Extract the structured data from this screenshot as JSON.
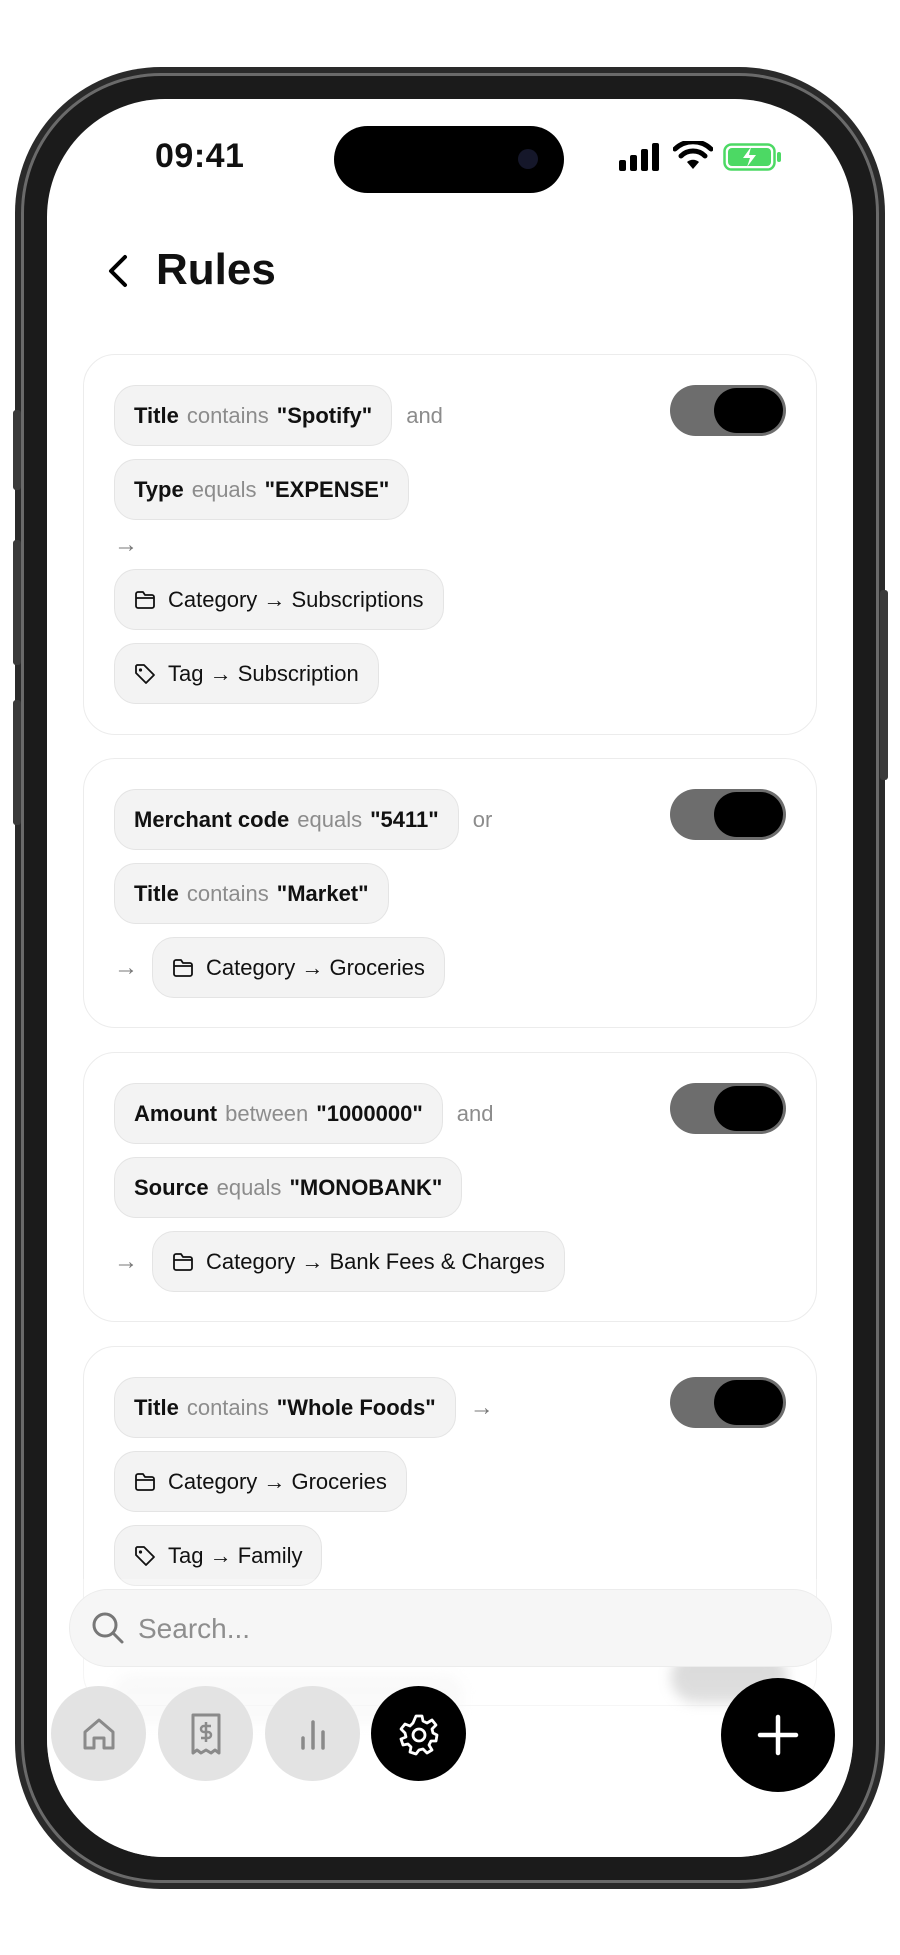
{
  "status": {
    "time": "09:41"
  },
  "header": {
    "title": "Rules"
  },
  "rules": [
    {
      "conditions": [
        {
          "field": "Title",
          "op": "contains",
          "value": "\"Spotify\"",
          "conj": "and"
        },
        {
          "field": "Type",
          "op": "equals",
          "value": "\"EXPENSE\""
        }
      ],
      "actions": [
        "Category → Subscriptions",
        "Tag → Subscription"
      ],
      "enabled": true
    },
    {
      "conditions": [
        {
          "field": "Merchant code",
          "op": "equals",
          "value": "\"5411\"",
          "conj": "or"
        },
        {
          "field": "Title",
          "op": "contains",
          "value": "\"Market\""
        }
      ],
      "actions": [
        "Category → Groceries"
      ],
      "enabled": true
    },
    {
      "conditions": [
        {
          "field": "Amount",
          "op": "between",
          "value": "\"1000000\"",
          "conj": "and"
        },
        {
          "field": "Source",
          "op": "equals",
          "value": "\"MONOBANK\""
        }
      ],
      "actions": [
        "Category → Bank Fees & Charges"
      ],
      "enabled": true
    },
    {
      "conditions": [
        {
          "field": "Title",
          "op": "contains",
          "value": "\"Whole Foods\""
        }
      ],
      "actions": [
        "Category → Groceries",
        "Tag → Family"
      ],
      "enabled": true
    }
  ],
  "arrow": "→",
  "search": {
    "placeholder": "Search..."
  },
  "nav": {
    "items": [
      {
        "icon": "home-icon"
      },
      {
        "icon": "receipt-icon"
      },
      {
        "icon": "bar-chart-icon"
      },
      {
        "icon": "gear-icon",
        "active": true
      }
    ],
    "fab_icon": "plus-icon"
  },
  "colors": {
    "toggle_track": "#6d6d6d",
    "toggle_knob": "#000000",
    "chip_bg": "#f3f3f3",
    "battery": "#4cd964"
  }
}
